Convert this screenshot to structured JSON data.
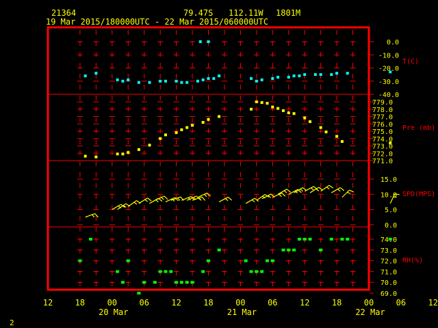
{
  "header": {
    "station": "21364",
    "lat": "79.47S",
    "lon": "112.11W",
    "elev": "1801M",
    "period": "19 Mar 2015/180000UTC - 22 Mar 2015/060000UTC"
  },
  "page_number": "2",
  "colors": {
    "frame": "#ff0000",
    "divider": "#ff0000",
    "grid": "#ff0000",
    "text": "#ffff00",
    "temperature": "#00ffff",
    "pressure": "#ffff00",
    "wind": "#ffff00",
    "rh": "#00ff00",
    "background": "#000000"
  },
  "chart_data": {
    "type": "scatter",
    "x_hour_labels": [
      "12",
      "18",
      "00",
      "06",
      "12",
      "18",
      "00",
      "06",
      "12",
      "18",
      "00",
      "06",
      "12"
    ],
    "x_day_labels": [
      "20 Mar",
      "21 Mar",
      "22 Mar"
    ],
    "panels": [
      {
        "key": "temp",
        "label": "T(C)",
        "ticks": [
          "0.0",
          "-10.0",
          "-20.0",
          "-30.0",
          "-40.0"
        ],
        "x": [
          "2015-03-19 19:00",
          "2015-03-19 21:00",
          "2015-03-20 01:00",
          "2015-03-20 02:00",
          "2015-03-20 03:00",
          "2015-03-20 05:00",
          "2015-03-20 07:00",
          "2015-03-20 09:00",
          "2015-03-20 10:00",
          "2015-03-20 12:00",
          "2015-03-20 13:00",
          "2015-03-20 14:00",
          "2015-03-20 16:00",
          "2015-03-20 17:00",
          "2015-03-20 18:00",
          "2015-03-20 19:00",
          "2015-03-20 20:00",
          "2015-03-20 16:30",
          "2015-03-20 18:00",
          "2015-03-21 02:00",
          "2015-03-21 03:00",
          "2015-03-21 04:00",
          "2015-03-21 06:00",
          "2015-03-21 07:00",
          "2015-03-21 09:00",
          "2015-03-21 10:00",
          "2015-03-21 11:00",
          "2015-03-21 12:00",
          "2015-03-21 14:00",
          "2015-03-21 15:00",
          "2015-03-21 17:00",
          "2015-03-21 18:00",
          "2015-03-21 20:00",
          "2015-03-22 04:00"
        ],
        "y": [
          -26,
          -24,
          -29,
          -30,
          -29,
          -31,
          -31,
          -30,
          -30,
          -30,
          -31,
          -31,
          -30,
          -29,
          -28,
          -28,
          -26,
          0,
          0,
          -28,
          -30,
          -29,
          -28,
          -27,
          -27,
          -26,
          -26,
          -25,
          -25,
          -25,
          -25,
          -24,
          -24,
          -23
        ]
      },
      {
        "key": "pressure",
        "label": "Pre (mb)",
        "ticks": [
          "779.0",
          "778.0",
          "777.0",
          "776.0",
          "775.0",
          "774.0",
          "773.0",
          "772.0",
          "771.0"
        ],
        "x": [
          "2015-03-19 19:00",
          "2015-03-19 21:00",
          "2015-03-20 01:00",
          "2015-03-20 02:00",
          "2015-03-20 03:00",
          "2015-03-20 05:00",
          "2015-03-20 07:00",
          "2015-03-20 09:00",
          "2015-03-20 10:00",
          "2015-03-20 12:00",
          "2015-03-20 13:00",
          "2015-03-20 14:00",
          "2015-03-20 15:00",
          "2015-03-20 17:00",
          "2015-03-20 18:00",
          "2015-03-20 20:00",
          "2015-03-21 02:00",
          "2015-03-21 03:00",
          "2015-03-21 04:00",
          "2015-03-21 05:00",
          "2015-03-21 06:00",
          "2015-03-21 07:00",
          "2015-03-21 08:00",
          "2015-03-21 09:00",
          "2015-03-21 10:00",
          "2015-03-21 12:00",
          "2015-03-21 13:00",
          "2015-03-21 15:00",
          "2015-03-21 16:00",
          "2015-03-21 18:00",
          "2015-03-21 19:00",
          "2015-03-22 04:00"
        ],
        "y": [
          771.6,
          771.5,
          771.9,
          771.9,
          772.1,
          772.5,
          773.1,
          774.0,
          774.5,
          774.8,
          775.2,
          775.5,
          775.8,
          776.2,
          776.6,
          777.0,
          778.0,
          779.0,
          778.9,
          778.8,
          778.3,
          778.1,
          777.8,
          777.5,
          777.4,
          776.8,
          776.3,
          775.5,
          774.9,
          774.3,
          773.6,
          773.4
        ]
      },
      {
        "key": "wind",
        "label": "SPD(MPS)",
        "ticks": [
          "15.0",
          "10.0",
          "5.0",
          "0.0"
        ],
        "x": [
          "2015-03-19 19:00",
          "2015-03-20 00:00",
          "2015-03-20 01:00",
          "2015-03-20 03:00",
          "2015-03-20 05:00",
          "2015-03-20 07:00",
          "2015-03-20 08:00",
          "2015-03-20 10:00",
          "2015-03-20 11:00",
          "2015-03-20 13:00",
          "2015-03-20 14:00",
          "2015-03-20 15:00",
          "2015-03-20 16:00",
          "2015-03-20 20:00",
          "2015-03-21 01:00",
          "2015-03-21 03:00",
          "2015-03-21 04:00",
          "2015-03-21 06:00",
          "2015-03-21 07:00",
          "2015-03-21 09:00",
          "2015-03-21 10:00",
          "2015-03-21 12:00",
          "2015-03-21 13:00",
          "2015-03-21 15:00",
          "2015-03-21 17:00",
          "2015-03-21 19:00",
          "2015-03-22 04:00"
        ],
        "y": [
          2.5,
          5.0,
          5.0,
          6.0,
          7.0,
          7.0,
          8.0,
          7.5,
          8.0,
          8.0,
          8.0,
          8.0,
          9.0,
          7.5,
          7.0,
          8.0,
          8.5,
          9.0,
          10.0,
          10.0,
          10.5,
          11.0,
          10.5,
          11.0,
          10.5,
          9.0,
          7.0
        ],
        "direction_deg": [
          250,
          240,
          235,
          235,
          238,
          240,
          245,
          245,
          250,
          248,
          245,
          250,
          245,
          242,
          240,
          235,
          242,
          245,
          240,
          242,
          240,
          242,
          238,
          235,
          240,
          225,
          205
        ]
      },
      {
        "key": "rh",
        "label": "RH(%)",
        "ticks": [
          "74.0",
          "73.0",
          "72.0",
          "71.0",
          "70.0",
          "69.0"
        ],
        "x": [
          "2015-03-19 18:00",
          "2015-03-19 20:00",
          "2015-03-20 01:00",
          "2015-03-20 02:00",
          "2015-03-20 03:00",
          "2015-03-20 05:00",
          "2015-03-20 06:00",
          "2015-03-20 08:00",
          "2015-03-20 09:00",
          "2015-03-20 10:00",
          "2015-03-20 11:00",
          "2015-03-20 12:00",
          "2015-03-20 13:00",
          "2015-03-20 14:00",
          "2015-03-20 15:00",
          "2015-03-20 17:00",
          "2015-03-20 18:00",
          "2015-03-20 20:00",
          "2015-03-21 01:00",
          "2015-03-21 02:00",
          "2015-03-21 03:00",
          "2015-03-21 04:00",
          "2015-03-21 05:00",
          "2015-03-21 06:00",
          "2015-03-21 08:00",
          "2015-03-21 09:00",
          "2015-03-21 10:00",
          "2015-03-21 11:00",
          "2015-03-21 12:00",
          "2015-03-21 13:00",
          "2015-03-21 15:00",
          "2015-03-21 17:00",
          "2015-03-21 19:00",
          "2015-03-21 20:00",
          "2015-03-22 04:00"
        ],
        "y": [
          72,
          74,
          71,
          70,
          72,
          69,
          70,
          70,
          71,
          71,
          71,
          70,
          70,
          70,
          70,
          71,
          72,
          73,
          72,
          71,
          71,
          71,
          72,
          72,
          73,
          73,
          73,
          74,
          74,
          74,
          73,
          74,
          74,
          74,
          74
        ]
      }
    ]
  }
}
